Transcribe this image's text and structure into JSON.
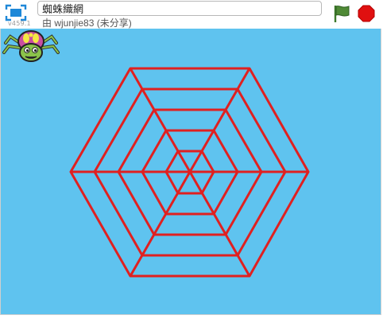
{
  "player": {
    "version": "v459.1",
    "project_title": "蜘蛛織網",
    "author_line": "由 wjunjie83 (未分享)"
  },
  "icons": {
    "fullscreen": "fullscreen-icon",
    "green_flag": "green-flag-icon",
    "stop": "stop-sign-icon"
  },
  "colors": {
    "stage_background": "#5fc3ef",
    "web_line": "#e02020",
    "flag": "#3f7a2c",
    "stop": "#e01010"
  }
}
